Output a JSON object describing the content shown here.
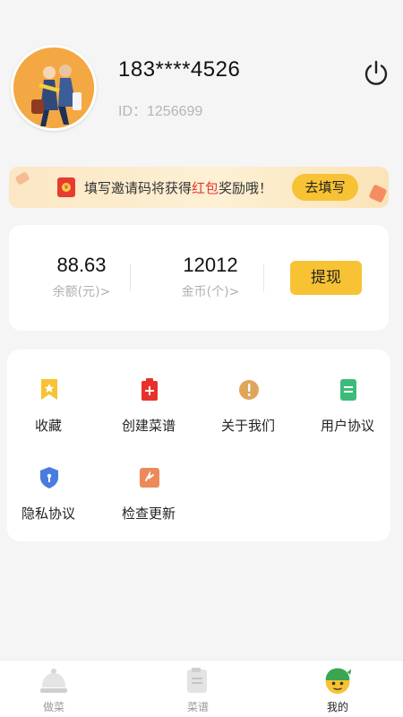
{
  "profile": {
    "phone": "183****4526",
    "id_text": "ID：1256699"
  },
  "banner": {
    "text_before": "填写邀请码将获得",
    "text_highlight": "红包",
    "text_after": "奖励哦！",
    "button_label": "去填写",
    "highlight_color": "#e53935"
  },
  "stats": {
    "balance_value": "88.63",
    "balance_label": "余额(元)>",
    "coins_value": "12012",
    "coins_label": "金币(个)>",
    "withdraw_label": "提现"
  },
  "menu": {
    "items": [
      {
        "label": "收藏",
        "icon": "bookmark-icon"
      },
      {
        "label": "创建菜谱",
        "icon": "add-recipe-icon"
      },
      {
        "label": "关于我们",
        "icon": "info-icon"
      },
      {
        "label": "用户协议",
        "icon": "document-icon"
      },
      {
        "label": "隐私协议",
        "icon": "shield-icon"
      },
      {
        "label": "检查更新",
        "icon": "update-icon"
      }
    ]
  },
  "tabbar": {
    "tabs": [
      {
        "label": "做菜",
        "icon": "cloche-icon",
        "active": false
      },
      {
        "label": "菜谱",
        "icon": "recipe-book-icon",
        "active": false
      },
      {
        "label": "我的",
        "icon": "profile-mascot-icon",
        "active": true
      }
    ]
  },
  "colors": {
    "accent": "#f7c233",
    "background": "#f5f5f5"
  }
}
